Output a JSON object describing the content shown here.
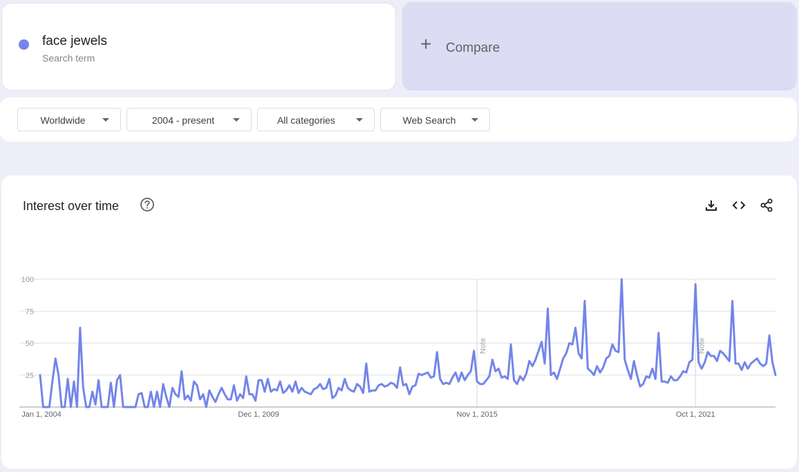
{
  "search_term": {
    "name": "face jewels",
    "subtitle": "Search term",
    "color": "#7385e9"
  },
  "compare": {
    "plus": "+",
    "label": "Compare"
  },
  "filters": {
    "region": "Worldwide",
    "time_range": "2004 - present",
    "category": "All categories",
    "property": "Web Search"
  },
  "chart_card": {
    "title": "Interest over time",
    "icons": [
      "help-icon",
      "download-icon",
      "embed-icon",
      "share-icon"
    ]
  },
  "chart_data": {
    "type": "line",
    "title": "Interest over time",
    "xlabel": "",
    "ylabel": "",
    "ylim": [
      0,
      100
    ],
    "y_ticks": [
      25,
      50,
      75,
      100
    ],
    "x_ticks": [
      {
        "label": "Jan 1, 2004",
        "date": "2004-01"
      },
      {
        "label": "Dec 1, 2009",
        "date": "2009-12"
      },
      {
        "label": "Nov 1, 2015",
        "date": "2015-11"
      },
      {
        "label": "Oct 1, 2021",
        "date": "2021-10"
      }
    ],
    "notes": [
      {
        "label": "Note",
        "date": "2015-11"
      },
      {
        "label": "Note",
        "date": "2021-10"
      }
    ],
    "grid": true,
    "legend": "none",
    "line_color": "#7385e9",
    "series": [
      {
        "start": "2004-01",
        "frequency": "monthly",
        "values": [
          25,
          0,
          0,
          0,
          20,
          38,
          25,
          0,
          0,
          22,
          0,
          20,
          0,
          62,
          15,
          0,
          0,
          12,
          2,
          21,
          0,
          0,
          0,
          19,
          0,
          21,
          25,
          0,
          0,
          0,
          0,
          0,
          10,
          11,
          0,
          0,
          12,
          0,
          12,
          0,
          18,
          8,
          0,
          15,
          10,
          8,
          28,
          6,
          9,
          5,
          20,
          17,
          6,
          10,
          0,
          13,
          8,
          4,
          10,
          15,
          10,
          6,
          6,
          17,
          5,
          10,
          7,
          24,
          10,
          10,
          5,
          21,
          21,
          12,
          22,
          12,
          14,
          13,
          20,
          11,
          13,
          17,
          12,
          20,
          11,
          15,
          12,
          11,
          10,
          14,
          15,
          18,
          14,
          15,
          22,
          7,
          9,
          15,
          13,
          22,
          15,
          13,
          12,
          18,
          16,
          11,
          34,
          12,
          13,
          13,
          17,
          18,
          16,
          17,
          19,
          18,
          15,
          31,
          17,
          18,
          10,
          16,
          17,
          26,
          25,
          26,
          27,
          23,
          24,
          43,
          22,
          18,
          19,
          18,
          23,
          27,
          20,
          27,
          21,
          25,
          28,
          44,
          20,
          18,
          18,
          21,
          24,
          37,
          28,
          30,
          23,
          24,
          22,
          49,
          21,
          18,
          24,
          21,
          26,
          36,
          32,
          37,
          44,
          51,
          34,
          77,
          25,
          27,
          22,
          30,
          38,
          42,
          50,
          49,
          62,
          42,
          38,
          83,
          30,
          28,
          25,
          32,
          27,
          31,
          38,
          40,
          49,
          44,
          43,
          100,
          37,
          29,
          22,
          36,
          25,
          16,
          18,
          24,
          23,
          30,
          22,
          58,
          20,
          20,
          19,
          24,
          21,
          21,
          24,
          28,
          27,
          35,
          37,
          96,
          35,
          30,
          35,
          43,
          40,
          40,
          36,
          44,
          42,
          39,
          36,
          83,
          34,
          34,
          29,
          35,
          30,
          34,
          36,
          38,
          34,
          32,
          34,
          56,
          35,
          25
        ]
      }
    ]
  }
}
